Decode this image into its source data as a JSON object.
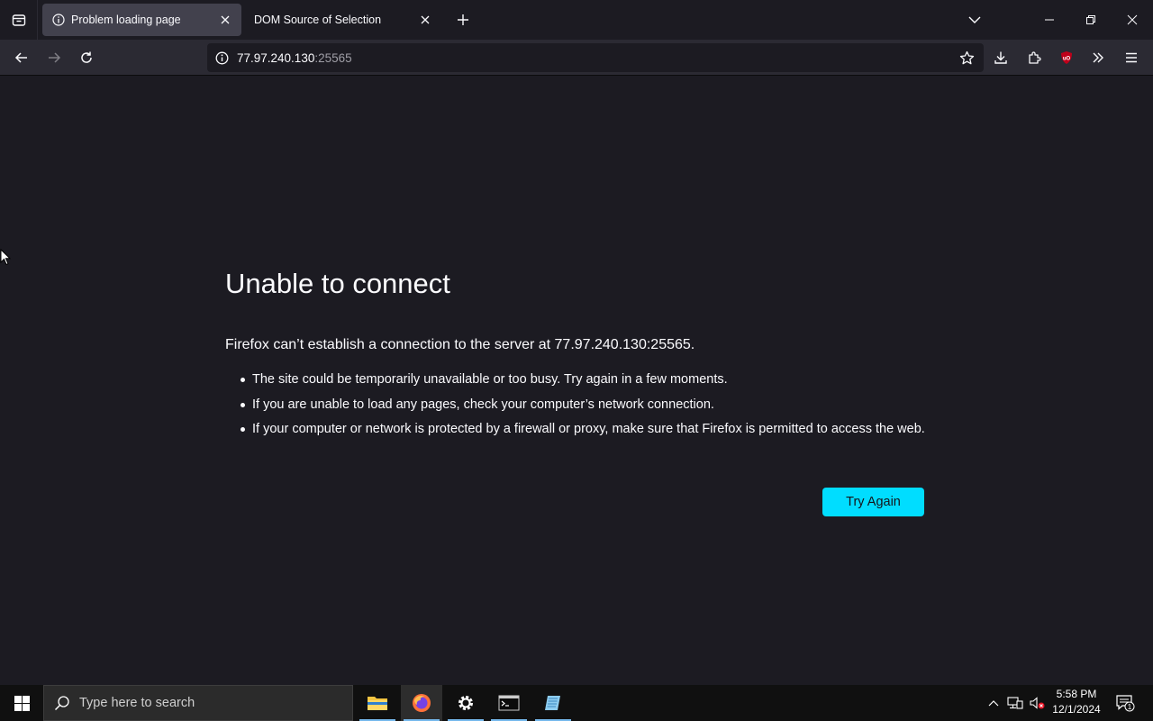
{
  "browser": {
    "tabs": [
      {
        "title": "Problem loading page",
        "active": true
      },
      {
        "title": "DOM Source of Selection",
        "active": false
      }
    ],
    "url": {
      "host": "77.97.240.130",
      "port": ":25565"
    }
  },
  "page": {
    "title": "Unable to connect",
    "intro": "Firefox can’t establish a connection to the server at 77.97.240.130:25565.",
    "bullets": [
      "The site could be temporarily unavailable or too busy. Try again in a few moments.",
      "If you are unable to load any pages, check your computer’s network connection.",
      "If your computer or network is protected by a firewall or proxy, make sure that Firefox is permitted to access the web."
    ],
    "try_again_label": "Try Again"
  },
  "taskbar": {
    "search_placeholder": "Type here to search",
    "time": "5:58 PM",
    "date": "12/1/2024",
    "notification_count": "1"
  },
  "colors": {
    "accent": "#00ddff",
    "background": "#1c1b22",
    "toolbar": "#2b2a33"
  }
}
